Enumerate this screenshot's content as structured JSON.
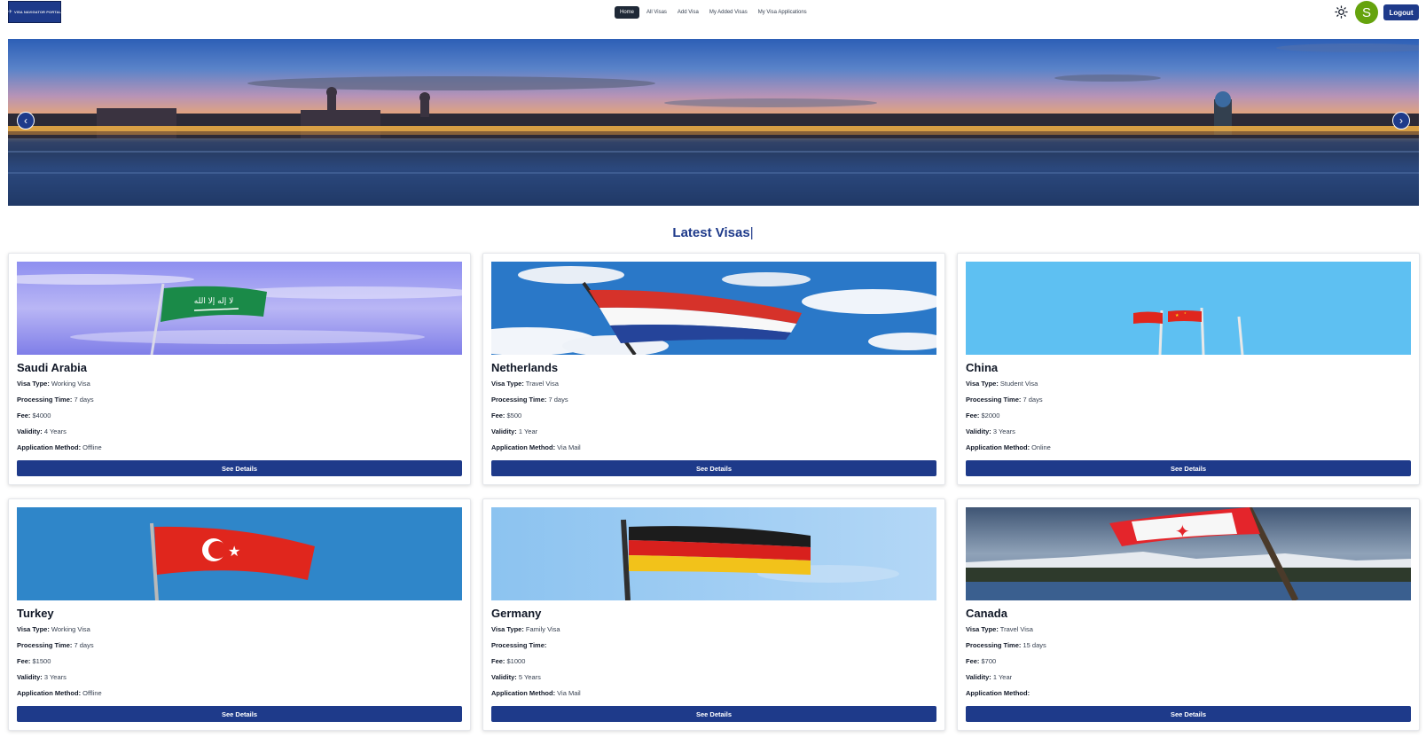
{
  "navbar": {
    "logo_text": "VISA NAVIGATOR PORTAL",
    "links": [
      "Home",
      "All Visas",
      "Add Visa",
      "My Added Visas",
      "My Visa Applications"
    ],
    "active_link": "Home",
    "theme_icon": "sun-icon",
    "avatar_initial": "S",
    "logout_label": "Logout"
  },
  "hero": {
    "prev_icon": "chevron-left-icon",
    "next_icon": "chevron-right-icon"
  },
  "section": {
    "title": "Latest Visas",
    "cursor": "|"
  },
  "cards": [
    {
      "country": "Saudi Arabia",
      "flag": "saudi-arabia-flag",
      "visa_type_label": "Visa Type:",
      "visa_type": "Working Visa",
      "processing_label": "Processing Time:",
      "processing_time": "7 days",
      "fee_label": "Fee:",
      "fee": "$4000",
      "validity_label": "Validity:",
      "validity": "4 Years",
      "method_label": "Application Method:",
      "method": "Offline",
      "button": "See Details"
    },
    {
      "country": "Netherlands",
      "flag": "netherlands-flag",
      "visa_type_label": "Visa Type:",
      "visa_type": "Travel Visa",
      "processing_label": "Processing Time:",
      "processing_time": "7 days",
      "fee_label": "Fee:",
      "fee": "$500",
      "validity_label": "Validity:",
      "validity": "1 Year",
      "method_label": "Application Method:",
      "method": "Via Mail",
      "button": "See Details"
    },
    {
      "country": "China",
      "flag": "china-flag",
      "visa_type_label": "Visa Type:",
      "visa_type": "Student Visa",
      "processing_label": "Processing Time:",
      "processing_time": "7 days",
      "fee_label": "Fee:",
      "fee": "$2000",
      "validity_label": "Validity:",
      "validity": "3 Years",
      "method_label": "Application Method:",
      "method": "Online",
      "button": "See Details"
    },
    {
      "country": "Turkey",
      "flag": "turkey-flag",
      "visa_type_label": "Visa Type:",
      "visa_type": "Working Visa",
      "processing_label": "Processing Time:",
      "processing_time": "7 days",
      "fee_label": "Fee:",
      "fee": "$1500",
      "validity_label": "Validity:",
      "validity": "3 Years",
      "method_label": "Application Method:",
      "method": "Offline",
      "button": "See Details"
    },
    {
      "country": "Germany",
      "flag": "germany-flag",
      "visa_type_label": "Visa Type:",
      "visa_type": "Family Visa",
      "processing_label": "Processing Time:",
      "processing_time": "",
      "fee_label": "Fee:",
      "fee": "$1000",
      "validity_label": "Validity:",
      "validity": "5 Years",
      "method_label": "Application Method:",
      "method": "Via Mail",
      "button": "See Details"
    },
    {
      "country": "Canada",
      "flag": "canada-flag",
      "visa_type_label": "Visa Type:",
      "visa_type": "Travel Visa",
      "processing_label": "Processing Time:",
      "processing_time": "15 days",
      "fee_label": "Fee:",
      "fee": "$700",
      "validity_label": "Validity:",
      "validity": "1 Year",
      "method_label": "Application Method:",
      "method": "",
      "button": "See Details"
    }
  ],
  "colors": {
    "primary": "#1e3a8a",
    "avatar": "#65a30d",
    "active_nav": "#1f2937"
  }
}
